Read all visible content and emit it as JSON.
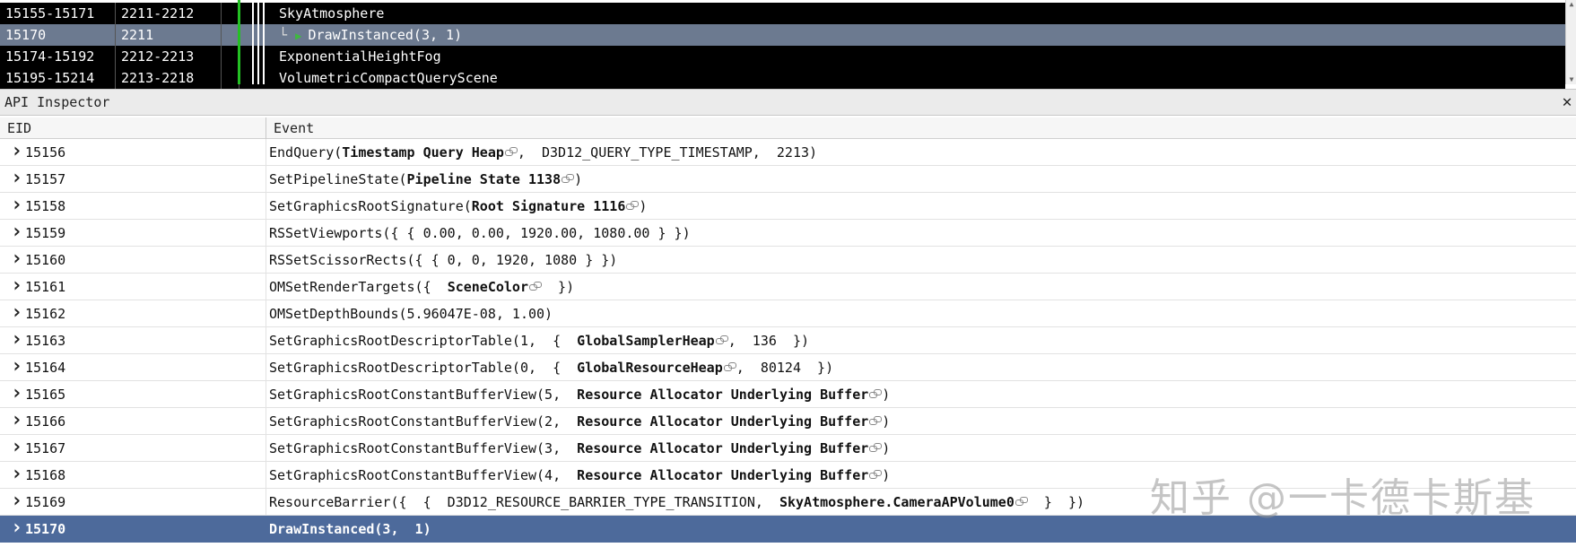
{
  "top_panel": {
    "rows": [
      {
        "eid": "15155-15171",
        "dur": "2211-2212",
        "name": "SkyAtmosphere",
        "indented": false,
        "selected": false
      },
      {
        "eid": "15170",
        "dur": "2211",
        "name": "DrawInstanced(3, 1)",
        "indented": true,
        "selected": true
      },
      {
        "eid": "15174-15192",
        "dur": "2212-2213",
        "name": "ExponentialHeightFog",
        "indented": false,
        "selected": false
      },
      {
        "eid": "15195-15214",
        "dur": "2213-2218",
        "name": "VolumetricCompactQueryScene",
        "indented": false,
        "selected": false
      }
    ]
  },
  "inspector": {
    "title": "API Inspector",
    "close_glyph": "✕",
    "columns": {
      "eid": "EID",
      "event": "Event"
    }
  },
  "events": [
    {
      "eid": "15156",
      "parts": [
        {
          "t": "EndQuery("
        },
        {
          "t": "Timestamp Query Heap",
          "b": true,
          "link": true
        },
        {
          "t": ",  D3D12_QUERY_TYPE_TIMESTAMP,  2213)"
        }
      ]
    },
    {
      "eid": "15157",
      "parts": [
        {
          "t": "SetPipelineState("
        },
        {
          "t": "Pipeline State 1138",
          "b": true,
          "link": true
        },
        {
          "t": ")"
        }
      ]
    },
    {
      "eid": "15158",
      "parts": [
        {
          "t": "SetGraphicsRootSignature("
        },
        {
          "t": "Root Signature 1116",
          "b": true,
          "link": true
        },
        {
          "t": ")"
        }
      ]
    },
    {
      "eid": "15159",
      "parts": [
        {
          "t": "RSSetViewports({ { 0.00, 0.00, 1920.00, 1080.00 } })"
        }
      ]
    },
    {
      "eid": "15160",
      "parts": [
        {
          "t": "RSSetScissorRects({ { 0, 0, 1920, 1080 } })"
        }
      ]
    },
    {
      "eid": "15161",
      "parts": [
        {
          "t": "OMSetRenderTargets({  "
        },
        {
          "t": "SceneColor",
          "b": true,
          "link": true
        },
        {
          "t": "  })"
        }
      ]
    },
    {
      "eid": "15162",
      "parts": [
        {
          "t": "OMSetDepthBounds(5.96047E-08, 1.00)"
        }
      ]
    },
    {
      "eid": "15163",
      "parts": [
        {
          "t": "SetGraphicsRootDescriptorTable(1,  {  "
        },
        {
          "t": "GlobalSamplerHeap",
          "b": true,
          "link": true
        },
        {
          "t": ",  136  })"
        }
      ]
    },
    {
      "eid": "15164",
      "parts": [
        {
          "t": "SetGraphicsRootDescriptorTable(0,  {  "
        },
        {
          "t": "GlobalResourceHeap",
          "b": true,
          "link": true
        },
        {
          "t": ",  80124  })"
        }
      ]
    },
    {
      "eid": "15165",
      "parts": [
        {
          "t": "SetGraphicsRootConstantBufferView(5,  "
        },
        {
          "t": "Resource Allocator Underlying Buffer",
          "b": true,
          "link": true
        },
        {
          "t": ")"
        }
      ]
    },
    {
      "eid": "15166",
      "parts": [
        {
          "t": "SetGraphicsRootConstantBufferView(2,  "
        },
        {
          "t": "Resource Allocator Underlying Buffer",
          "b": true,
          "link": true
        },
        {
          "t": ")"
        }
      ]
    },
    {
      "eid": "15167",
      "parts": [
        {
          "t": "SetGraphicsRootConstantBufferView(3,  "
        },
        {
          "t": "Resource Allocator Underlying Buffer",
          "b": true,
          "link": true
        },
        {
          "t": ")"
        }
      ]
    },
    {
      "eid": "15168",
      "parts": [
        {
          "t": "SetGraphicsRootConstantBufferView(4,  "
        },
        {
          "t": "Resource Allocator Underlying Buffer",
          "b": true,
          "link": true
        },
        {
          "t": ")"
        }
      ]
    },
    {
      "eid": "15169",
      "parts": [
        {
          "t": "ResourceBarrier({  {  D3D12_RESOURCE_BARRIER_TYPE_TRANSITION,  "
        },
        {
          "t": "SkyAtmosphere.CameraAPVolume0",
          "b": true,
          "link": true
        },
        {
          "t": "  }  })"
        }
      ]
    },
    {
      "eid": "15170",
      "parts": [
        {
          "t": "DrawInstanced(3,  1)"
        }
      ],
      "selected": true
    }
  ],
  "watermark": "知乎 @一卡德卡斯基",
  "colors": {
    "top_row_bg": "#000000",
    "top_selected_bg": "#6c7a90",
    "selected_row_bg": "#4d6a9b",
    "marker_green": "#24c024"
  }
}
